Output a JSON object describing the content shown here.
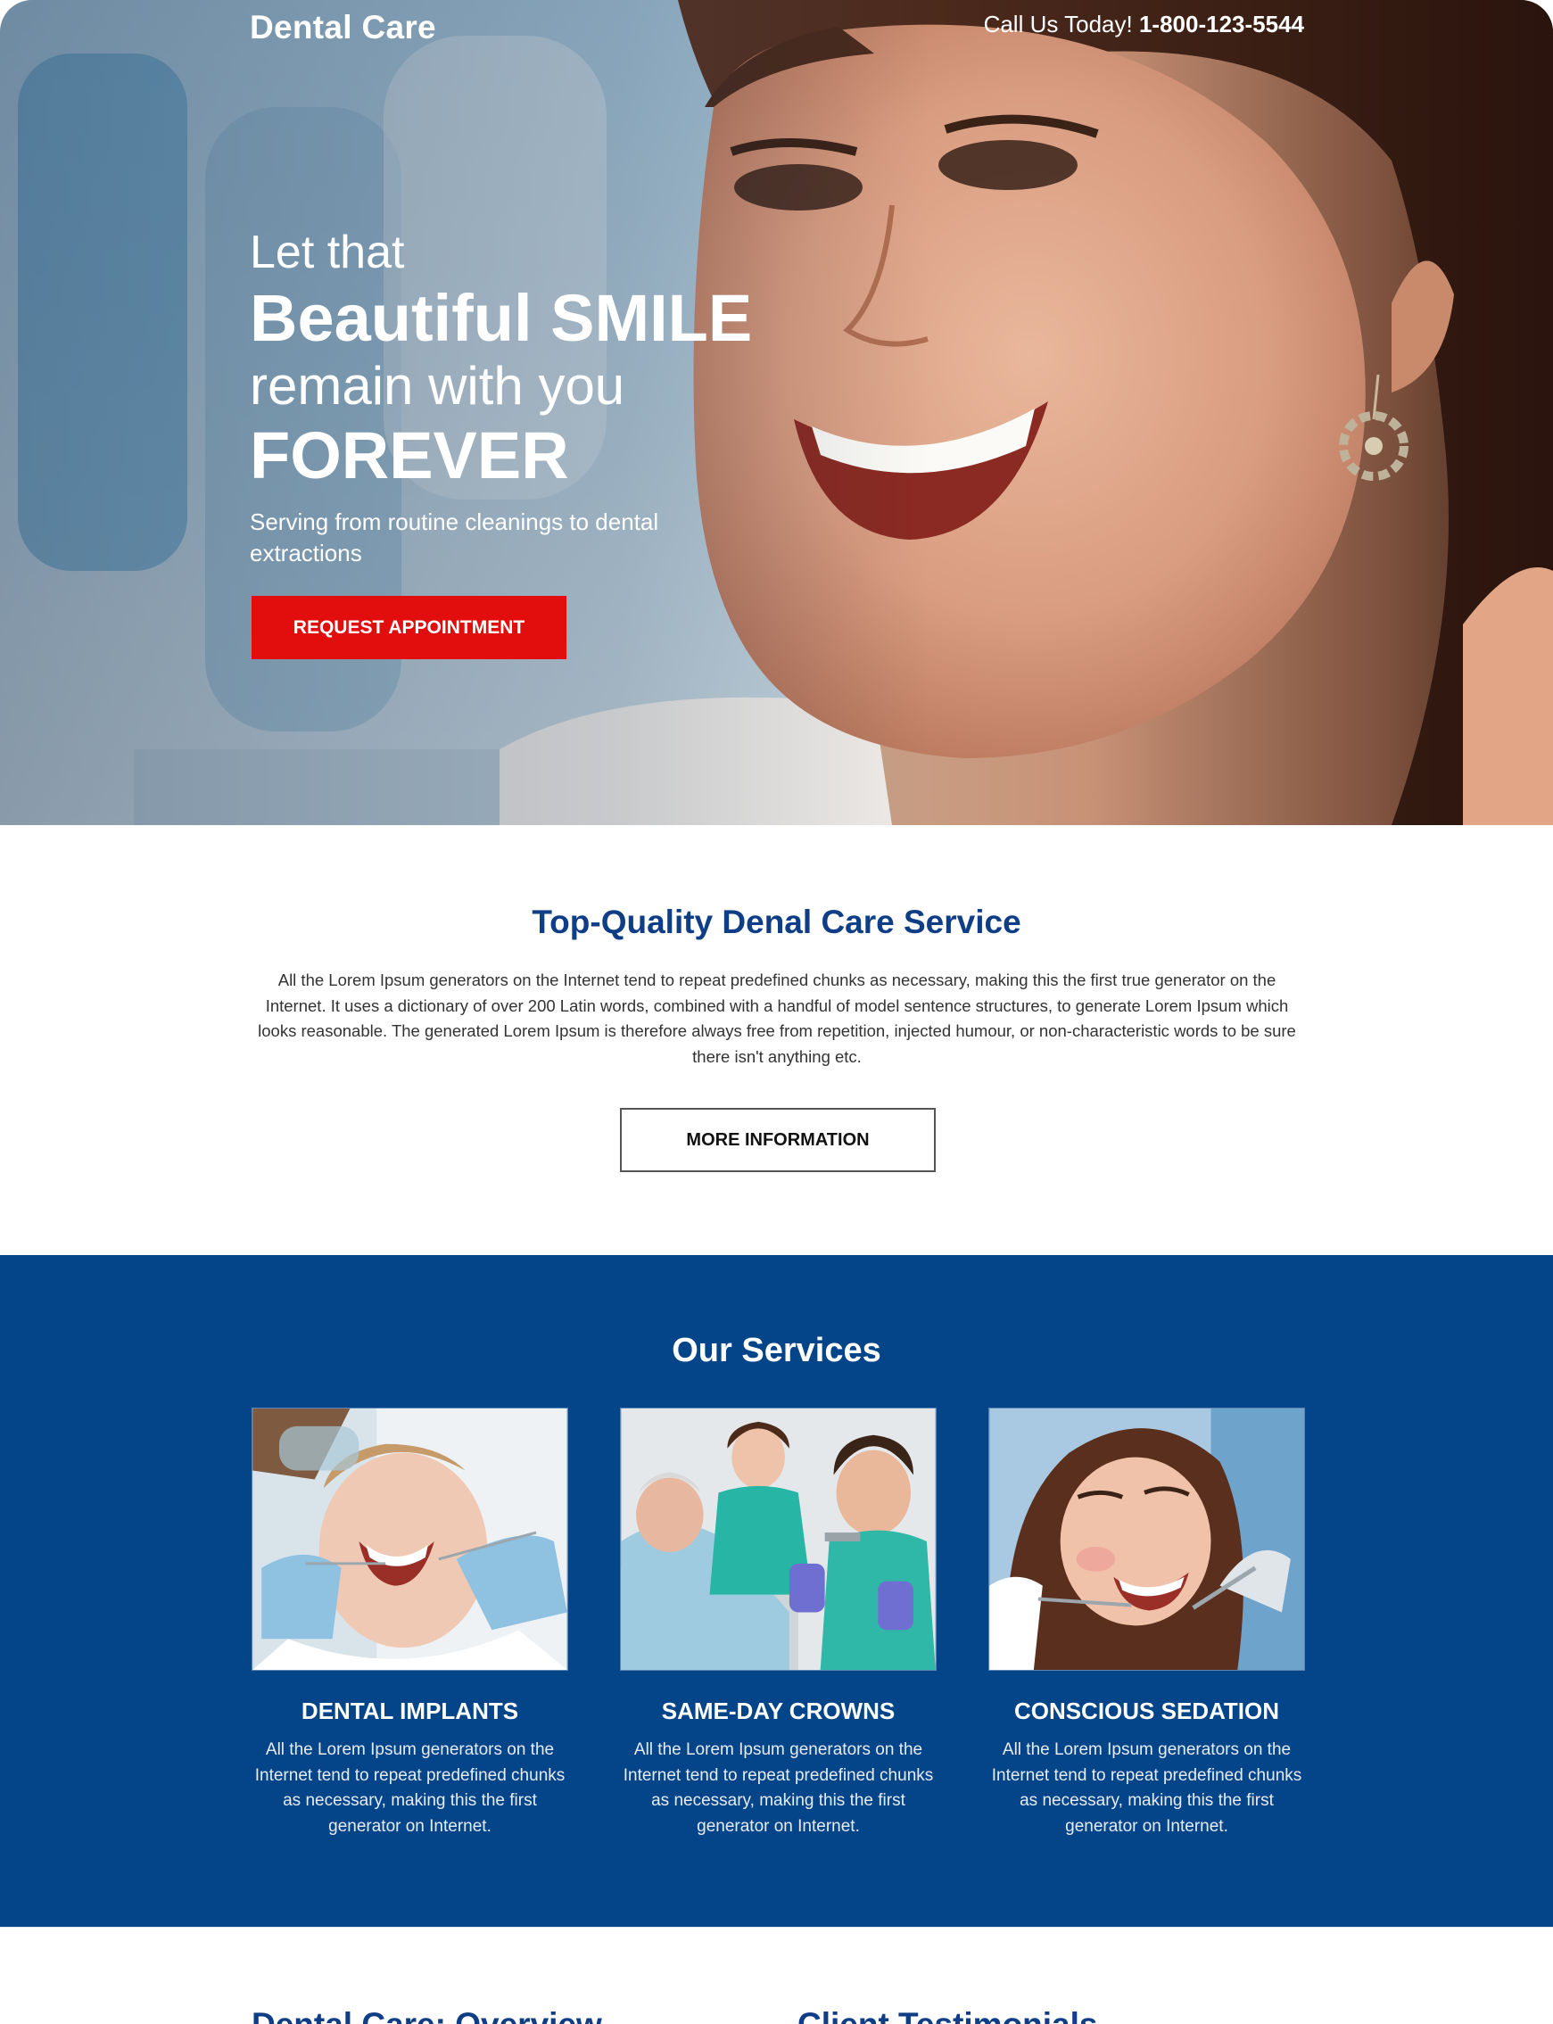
{
  "header": {
    "brand": "Dental Care",
    "call_label": "Call Us Today!",
    "phone": "1-800-123-5544"
  },
  "hero": {
    "line1": "Let that",
    "line2": "Beautiful SMILE",
    "line3": "remain with you",
    "line4": "FOREVER",
    "subtitle": "Serving from routine cleanings to dental extractions",
    "cta_label": "Request Appointment"
  },
  "about": {
    "title": "Top-Quality Denal Care Service",
    "body": "All the Lorem Ipsum generators on the Internet tend to repeat predefined chunks as necessary, making this the first true generator on the Internet. It uses a dictionary of over 200 Latin words, combined with a handful of model sentence structures, to generate Lorem Ipsum which looks reasonable. The generated Lorem Ipsum is therefore always free from repetition, injected humour, or non-characteristic words to be sure there isn't anything etc.",
    "button_label": "More Information"
  },
  "services": {
    "title": "Our Services",
    "items": [
      {
        "title": "Dental Implants",
        "text": "All the Lorem Ipsum generators on the Internet tend to repeat predefined chunks as necessary, making this the first generator on Internet."
      },
      {
        "title": "Same-Day Crowns",
        "text": "All the Lorem Ipsum generators on the Internet tend to repeat predefined chunks as necessary, making this the first generator on Internet."
      },
      {
        "title": "Conscious Sedation",
        "text": "All the Lorem Ipsum generators on the Internet tend to repeat predefined chunks as necessary, making this the first generator on Internet."
      }
    ]
  },
  "bottom": {
    "overview_title": "Dental Care: Overview",
    "testimonials_title": "Client Testimonials"
  },
  "colors": {
    "brand_blue": "#044489",
    "title_blue": "#0f3d86",
    "cta_red": "#e20d0d"
  }
}
